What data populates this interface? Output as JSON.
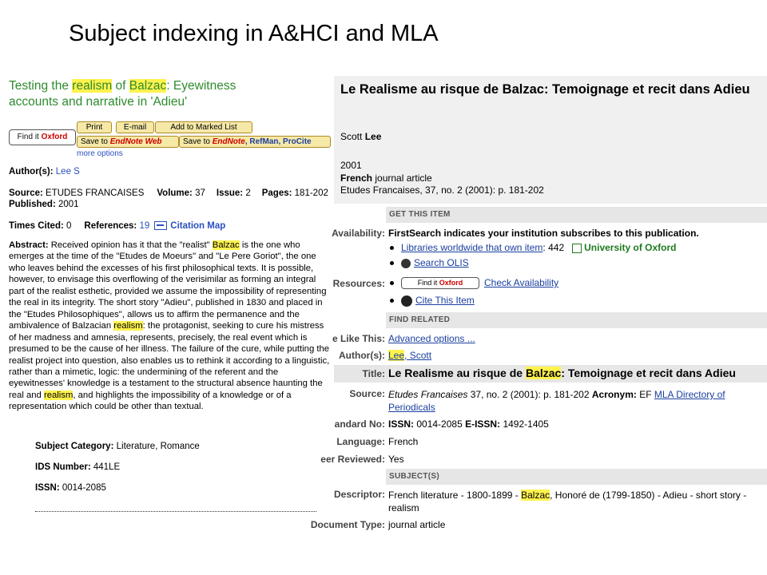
{
  "slide": {
    "title": "Subject indexing in A&HCI and MLA"
  },
  "wos": {
    "title_pre": "Testing the ",
    "title_hl1": "realism",
    "title_mid": " of ",
    "title_hl2": "Balzac",
    "title_post": ": Eyewitness accounts and narrative in 'Adieu'",
    "find_it": {
      "text": "Find it",
      "brand": "Oxford"
    },
    "buttons": {
      "print": "Print",
      "email": "E-mail",
      "add_marked": "Add to Marked List"
    },
    "save_endnote_web": {
      "pre": "Save to ",
      "brand": "EndNote",
      "suffix": " Web"
    },
    "save_endnote": {
      "pre": "Save to ",
      "brand": "EndNote",
      "rest": ", RefMan, ProCite"
    },
    "more_options": "more options",
    "authors_label": "Author(s):",
    "authors_value": "Lee S",
    "source_label": "Source:",
    "source_value": "ETUDES FRANCAISES",
    "volume_label": "Volume:",
    "volume_value": "37",
    "issue_label": "Issue:",
    "issue_value": "2",
    "pages_label": "Pages:",
    "pages_value": "181-202",
    "published_label": "Published:",
    "published_value": "2001",
    "times_cited_label": "Times Cited:",
    "times_cited_value": "0",
    "references_label": "References:",
    "references_value": "19",
    "citation_map": "Citation Map",
    "abstract_label": "Abstract:",
    "abstract_1": " Received opinion has it that the \"realist\" ",
    "abstract_hl1": "Balzac",
    "abstract_2": " is the one who emerges at the time of the \"Etudes de Moeurs\" and \"Le Pere Goriot\", the one who leaves behind the excesses of his first philosophical texts. It is possible, however, to envisage this overflowing of the verisimilar as forming an integral part of the realist esthetic, provided we assume the impossibility of representing the real in its integrity. The short story \"Adieu\", published in 1830 and placed in the \"Etudes Philosophiques\", allows us to affirm the permanence and the ambivalence of Balzacian ",
    "abstract_hl2": "realism",
    "abstract_3": ": the protagonist, seeking to cure his mistress of her madness and amnesia, represents, precisely, the real event which is presumed to be the cause of her illness. The failure of the cure, while putting the realist project into question, also enables us to rethink it according to a linguistic, rather than a mimetic, logic: the undermining of the referent and the eyewitnesses' knowledge is a testament to the structural absence haunting the real and ",
    "abstract_hl3": "realism",
    "abstract_4": ", and highlights the impossibility of a knowledge or of a representation which could be other than textual.",
    "subject_category_label": "Subject Category:",
    "subject_category_value": "Literature, Romance",
    "ids_label": "IDS Number:",
    "ids_value": "441LE",
    "issn_label": "ISSN:",
    "issn_value": "0014-2085"
  },
  "fs": {
    "title": "Le Realisme au risque de Balzac: Temoignage et recit dans Adieu",
    "author_first": "Scott ",
    "author_last": "Lee",
    "year": "2001",
    "type_bold": "French",
    "type_rest": " journal article",
    "citation": "Etudes Francaises, 37, no. 2 (2001): p. 181-202",
    "get_this_item": "GET THIS ITEM",
    "availability_label": "Availability:",
    "availability_value": "FirstSearch indicates your institution subscribes to this publication.",
    "libraries_link": "Libraries worldwide that own item",
    "libraries_count": ": 442",
    "university": "University of Oxford",
    "search_olis": "Search OLIS",
    "resources_label": "Resources:",
    "find_it": {
      "text": "Find it",
      "brand": "Oxford"
    },
    "check_availability": "Check Availability",
    "cite_this_item": "Cite This Item",
    "find_related": "FIND RELATED",
    "more_like_label": "e Like This:",
    "advanced_options": "Advanced options ...",
    "author_label": "Author(s):",
    "author_hl": "Lee",
    "author_link_rest": ", Scott",
    "title_label": "Title:",
    "title_pre": "Le Realisme au risque de ",
    "title_hl": "Balzac",
    "title_post": ": Temoignage et recit dans Adieu",
    "source_label": "Source:",
    "source_journal": "Etudes Francaises",
    "source_rest": " 37, no. 2 (2001): p. 181-202",
    "acronym_label": "Acronym:",
    "acronym_value": "EF",
    "mla_directory": "MLA Directory of",
    "periodicals": "Periodicals",
    "standard_no_label": "andard No:",
    "issn_label": "ISSN:",
    "issn_value": "0014-2085",
    "eissn_label": "E-ISSN:",
    "eissn_value": "1492-1405",
    "language_label": "Language:",
    "language_value": "French",
    "peer_label": "eer Reviewed:",
    "peer_value": "Yes",
    "subjects": "SUBJECT(S)",
    "descriptor_label": "Descriptor:",
    "descriptor_pre": "French literature - 1800-1899 - ",
    "descriptor_hl": "Balzac",
    "descriptor_post": ", Honoré de (1799-1850) - Adieu - short story -",
    "descriptor_line2": "realism",
    "doctype_label": "Document Type:",
    "doctype_value": "journal article"
  }
}
